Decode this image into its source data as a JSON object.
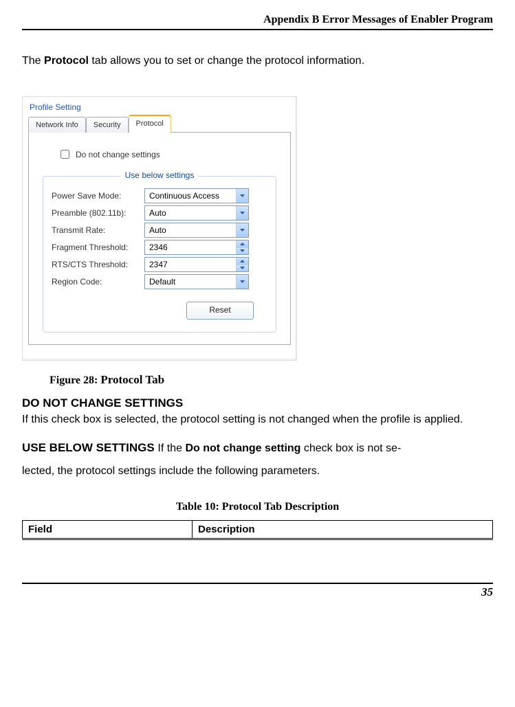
{
  "header": "Appendix B Error Messages of Enabler Program",
  "intro": {
    "pre": "The ",
    "bold": "Protocol",
    "post": " tab allows you to set or change the protocol information."
  },
  "screenshot": {
    "group_title": "Profile Setting",
    "tabs": {
      "t0": "Network Info",
      "t1": "Security",
      "t2": "Protocol"
    },
    "checkbox_label": "Do not change settings",
    "legend": "Use below settings",
    "rows": {
      "r0": {
        "label": "Power Save Mode:",
        "value": "Continuous Access",
        "type": "select"
      },
      "r1": {
        "label": "Preamble (802.11b):",
        "value": "Auto",
        "type": "select"
      },
      "r2": {
        "label": "Transmit Rate:",
        "value": "Auto",
        "type": "select"
      },
      "r3": {
        "label": "Fragment Threshold:",
        "value": "2346",
        "type": "spin"
      },
      "r4": {
        "label": "RTS/CTS Threshold:",
        "value": "2347",
        "type": "spin"
      },
      "r5": {
        "label": "Region Code:",
        "value": "Default",
        "type": "select"
      }
    },
    "reset": "Reset"
  },
  "figure_caption": {
    "lead": "Figure 28: ",
    "title": "Protocol Tab"
  },
  "section1": {
    "heading": "DO NOT CHANGE SETTINGS",
    "body": "If this check box is selected, the protocol setting is not changed when the profile is applied."
  },
  "section2": {
    "lead": "USE BELOW SETTINGS ",
    "mid1": "If the ",
    "bold": "Do not change setting",
    "mid2": " check box is not se-",
    "line2": "lected, the protocol settings include the following parameters."
  },
  "table_caption": "Table 10: Protocol Tab Description",
  "table": {
    "h0": "Field",
    "h1": "Description"
  },
  "page_number": "35"
}
